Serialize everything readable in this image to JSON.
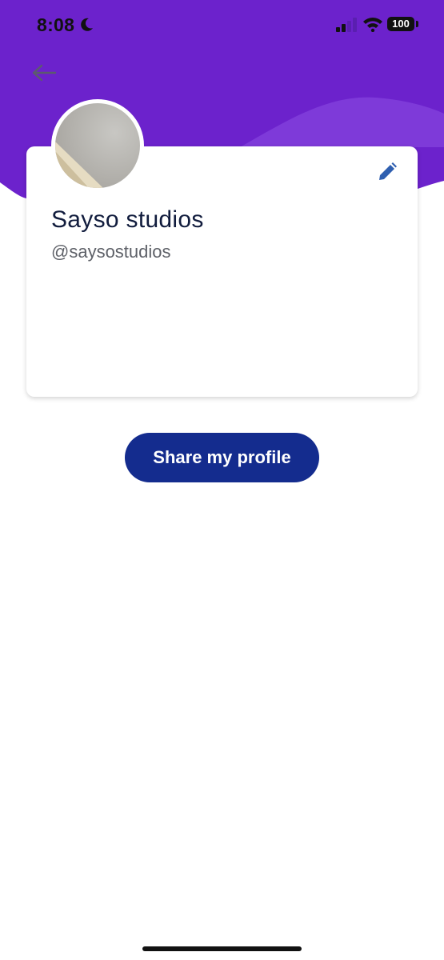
{
  "status_bar": {
    "time": "8:08",
    "battery": "100",
    "moon_icon": "moon-icon",
    "signal_icon": "cellular-signal-icon",
    "wifi_icon": "wifi-icon"
  },
  "header": {
    "back_icon": "arrow-left-icon",
    "background_color": "#6c22cc",
    "wave_color": "#7e3ad9"
  },
  "profile": {
    "name": "Sayso studios",
    "handle": "@saysostudios",
    "edit_icon": "pencil-icon"
  },
  "actions": {
    "share_label": "Share my profile",
    "share_color": "#142c8e"
  }
}
